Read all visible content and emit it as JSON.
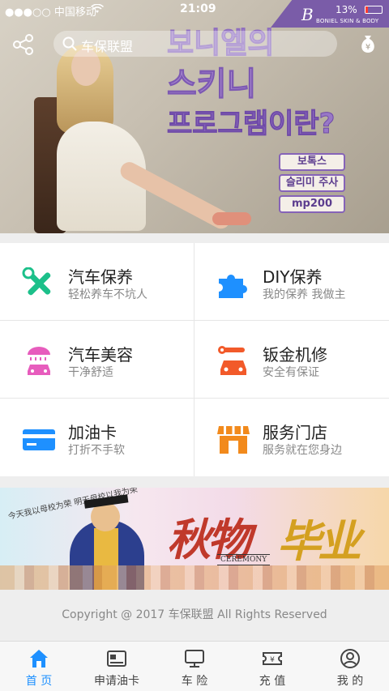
{
  "status_bar": {
    "carrier": "●●●○○ 中国移动",
    "time": "21:09",
    "battery": "13%"
  },
  "brand": {
    "logo": "B",
    "subtitle": "BONIEL SKIN & BODY"
  },
  "search": {
    "placeholder": "车保联盟"
  },
  "banner": {
    "line1": "보니엘의",
    "line2": "스키니",
    "line3": "프로그램이란?",
    "tags": [
      "보톡스",
      "슬리미 주사",
      "mp200"
    ]
  },
  "services": [
    {
      "title": "汽车保养",
      "subtitle": "轻松养车不坑人",
      "icon": "tools-icon",
      "color": "#1cc08a"
    },
    {
      "title": "DIY保养",
      "subtitle": "我的保养 我做主",
      "icon": "puzzle-icon",
      "color": "#1e90ff"
    },
    {
      "title": "汽车美容",
      "subtitle": "干净舒适",
      "icon": "car-wash-icon",
      "color": "#e75cbd"
    },
    {
      "title": "钣金机修",
      "subtitle": "安全有保证",
      "icon": "car-repair-icon",
      "color": "#f25a2a"
    },
    {
      "title": "加油卡",
      "subtitle": "打折不手软",
      "icon": "card-icon",
      "color": "#1e90ff"
    },
    {
      "title": "服务门店",
      "subtitle": "服务就在您身边",
      "icon": "store-icon",
      "color": "#f28a1c"
    }
  ],
  "promo_banner": {
    "motto": "今天我以母校为荣 明天母校以我为荣",
    "seal": "CEREMONY"
  },
  "copyright": "Copyright @ 2017 车保联盟 All Rights Reserved",
  "tabs": [
    {
      "label": "首 页",
      "icon": "home-icon",
      "active": true
    },
    {
      "label": "申请油卡",
      "icon": "fuel-card-icon",
      "active": false
    },
    {
      "label": "车 险",
      "icon": "monitor-icon",
      "active": false
    },
    {
      "label": "充 值",
      "icon": "ticket-icon",
      "active": false
    },
    {
      "label": "我 的",
      "icon": "user-icon",
      "active": false
    }
  ],
  "colors": {
    "accent": "#1e90ff",
    "brand_purple": "#7a5ca8",
    "text_muted": "#888888"
  }
}
